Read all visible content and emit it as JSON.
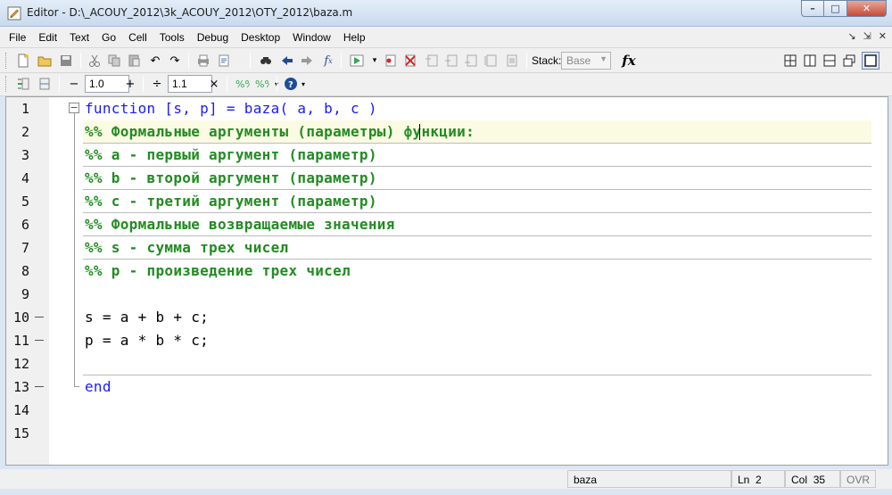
{
  "window": {
    "title": "Editor - D:\\_ACOUY_2012\\3k_ACOUY_2012\\OTY_2012\\baza.m",
    "minimize": "–",
    "maximize": "□",
    "close": "✕"
  },
  "menu": [
    "File",
    "Edit",
    "Text",
    "Go",
    "Cell",
    "Tools",
    "Debug",
    "Desktop",
    "Window",
    "Help"
  ],
  "menu_right": [
    "↘",
    "⇲",
    "✕"
  ],
  "toolbar": {
    "stack_label": "Stack:",
    "stack_value": "Base",
    "fx_label": "fx",
    "icons": [
      "new-file-icon",
      "open-folder-icon",
      "save-icon",
      "cut-icon",
      "copy-icon",
      "paste-icon",
      "undo-icon",
      "redo-icon",
      "print-icon",
      "find-files-icon",
      "find-icon",
      "back-icon",
      "forward-icon",
      "function-browser-icon",
      "run-icon",
      "breakpoint-set-icon",
      "breakpoint-clear-icon",
      "step-icon",
      "step-in-icon",
      "step-out-icon",
      "continue-icon",
      "exit-debug-icon",
      "tile-grid-icon",
      "tile-columns-icon",
      "tile-rows-icon",
      "float-icon",
      "maximize-doc-icon"
    ]
  },
  "cell_toolbar": {
    "minus": "−",
    "step1": "1.0",
    "plus": "+",
    "divide": "÷",
    "step2": "1.1",
    "times": "×",
    "help": "?"
  },
  "code": {
    "lines": [
      {
        "n": "1",
        "text": "function [s, p] = baza( a, b, c )"
      },
      {
        "n": "2",
        "text": "%% Формальные аргументы (параметры) функции:"
      },
      {
        "n": "3",
        "text": "%% a - первый аргумент (параметр)"
      },
      {
        "n": "4",
        "text": "%% b - второй аргумент (параметр)"
      },
      {
        "n": "5",
        "text": "%% c - третий аргумент (параметр)"
      },
      {
        "n": "6",
        "text": "%% Формальные возвращаемые значения"
      },
      {
        "n": "7",
        "text": "%% s - сумма трех чисел"
      },
      {
        "n": "8",
        "text": "%% p - произведение трех чисел"
      },
      {
        "n": "9",
        "text": ""
      },
      {
        "n": "10",
        "text": "s = a + b + c;"
      },
      {
        "n": "11",
        "text": "p = a * b * c;"
      },
      {
        "n": "12",
        "text": ""
      },
      {
        "n": "13",
        "text": "end"
      },
      {
        "n": "14",
        "text": ""
      },
      {
        "n": "15",
        "text": ""
      }
    ]
  },
  "status": {
    "function_name": "baza",
    "ln_label": "Ln",
    "ln_value": "2",
    "col_label": "Col",
    "col_value": "35",
    "mode": "OVR"
  }
}
